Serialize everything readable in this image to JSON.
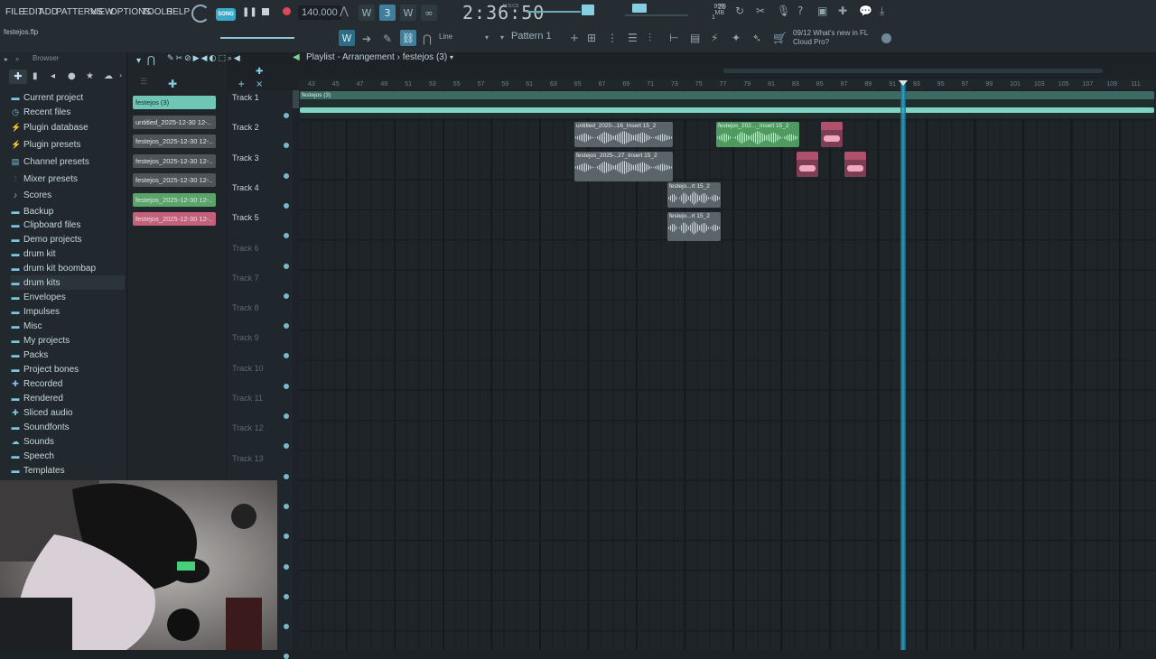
{
  "menu": [
    "FILE",
    "EDIT",
    "ADD",
    "PATTERNS",
    "VIEW",
    "OPTIONS",
    "TOOLS",
    "HELP"
  ],
  "transport": {
    "mode_label": "SONG",
    "bpm": "140.000",
    "time": "2:36:50",
    "time_unit": "M:S:CS",
    "cpu": "29",
    "memory": "999 MB",
    "voices": "1"
  },
  "project_file": "festejos.flp",
  "toolbar": {
    "snap": "Line",
    "pattern": "Pattern 1"
  },
  "news": {
    "date": "09/12",
    "text": "What's new in FL Cloud Pro?"
  },
  "browser": {
    "title": "Browser",
    "items": [
      {
        "label": "Current project",
        "icon": "folder-open-icon"
      },
      {
        "label": "Recent files",
        "icon": "clock-icon"
      },
      {
        "label": "Plugin database",
        "icon": "plug-icon"
      },
      {
        "label": "Plugin presets",
        "icon": "plug-icon"
      },
      {
        "label": "Channel presets",
        "icon": "channel-icon"
      },
      {
        "label": "Mixer presets",
        "icon": "mixer-icon"
      },
      {
        "label": "Scores",
        "icon": "note-icon"
      },
      {
        "label": "Backup",
        "icon": "folder-icon"
      },
      {
        "label": "Clipboard files",
        "icon": "folder-icon"
      },
      {
        "label": "Demo projects",
        "icon": "folder-icon"
      },
      {
        "label": "drum kit",
        "icon": "folder-icon"
      },
      {
        "label": "drum kit boombap",
        "icon": "folder-icon"
      },
      {
        "label": "drum kits",
        "icon": "folder-icon"
      },
      {
        "label": "Envelopes",
        "icon": "folder-icon"
      },
      {
        "label": "Impulses",
        "icon": "folder-icon"
      },
      {
        "label": "Misc",
        "icon": "folder-icon"
      },
      {
        "label": "My projects",
        "icon": "folder-icon"
      },
      {
        "label": "Packs",
        "icon": "folder-icon"
      },
      {
        "label": "Project bones",
        "icon": "folder-icon"
      },
      {
        "label": "Recorded",
        "icon": "plus-icon"
      },
      {
        "label": "Rendered",
        "icon": "folder-icon"
      },
      {
        "label": "Sliced audio",
        "icon": "plus-icon"
      },
      {
        "label": "Soundfonts",
        "icon": "folder-icon"
      },
      {
        "label": "Sounds",
        "icon": "cloud-icon"
      },
      {
        "label": "Speech",
        "icon": "folder-icon"
      },
      {
        "label": "Templates",
        "icon": "folder-icon"
      }
    ]
  },
  "clip_picker": [
    {
      "label": "festejos (3)",
      "color": "#6fc6b4"
    },
    {
      "label": "untitled_2025-12-30 12-..",
      "color": "#4e5558"
    },
    {
      "label": "festejos_2025-12-30 12-..",
      "color": "#4e5558"
    },
    {
      "label": "festejos_2025-12-30 12-..",
      "color": "#4e5558"
    },
    {
      "label": "festejos_2025-12-30 12-..",
      "color": "#4e5558"
    },
    {
      "label": "festejos_2025-12-30 12-..",
      "color": "#5aa36a"
    },
    {
      "label": "festejos_2025-12-30 12-..",
      "color": "#c4607a"
    }
  ],
  "playlist": {
    "title": "Playlist - Arrangement",
    "arrangement": "festejos (3)",
    "ruler": [
      "43",
      "45",
      "47",
      "49",
      "51",
      "53",
      "55",
      "57",
      "59",
      "61",
      "63",
      "65",
      "67",
      "69",
      "71",
      "73",
      "75",
      "77",
      "79",
      "81",
      "83",
      "85",
      "87",
      "89",
      "91",
      "93",
      "95",
      "97",
      "99",
      "101",
      "103",
      "105",
      "107",
      "109",
      "111"
    ],
    "tracks": [
      "Track 1",
      "Track 2",
      "Track 3",
      "Track 4",
      "Track 5",
      "Track 6",
      "Track 7",
      "Track 8",
      "Track 9",
      "Track 10",
      "Track 11",
      "Track 12",
      "Track 13"
    ],
    "clips": [
      {
        "label": "untitled_2025-..16_Insert 15_2"
      },
      {
        "label": "festejos_202..._Insert 15_2"
      },
      {
        "label": "festejos_2025-..27_Insert 15_2"
      },
      {
        "label": "festejo...rt 15_2"
      },
      {
        "label": "festejo...rt 15_2"
      },
      {
        "label": "festejos (3)"
      }
    ]
  },
  "colors": {
    "accent": "#3aa9c9",
    "teal_clip": "#6fc6b4",
    "green_clip": "#5aa36a",
    "pink_clip": "#c4607a",
    "grey_clip": "#5a6266"
  }
}
